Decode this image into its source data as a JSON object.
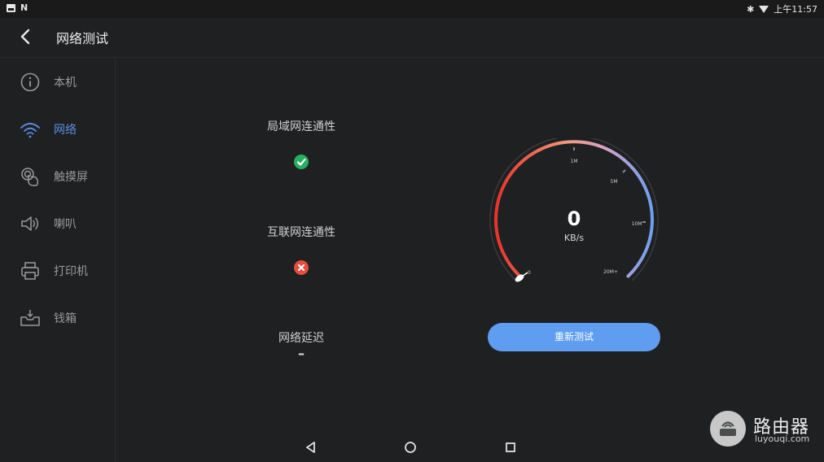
{
  "statusbar": {
    "left_glyph": "N",
    "bluetooth_glyph": "✱",
    "time": "上午11:57"
  },
  "header": {
    "title": "网络测试",
    "back_icon": "chevron-left-icon"
  },
  "sidebar": {
    "items": [
      {
        "label": "本机",
        "icon": "info-icon",
        "active": false
      },
      {
        "label": "网络",
        "icon": "wifi-icon",
        "active": true
      },
      {
        "label": "触摸屏",
        "icon": "touch-icon",
        "active": false
      },
      {
        "label": "喇叭",
        "icon": "speaker-icon",
        "active": false
      },
      {
        "label": "打印机",
        "icon": "printer-icon",
        "active": false
      },
      {
        "label": "钱箱",
        "icon": "cash-drawer-icon",
        "active": false
      }
    ]
  },
  "main": {
    "lan": {
      "label": "局域网连通性",
      "status": "ok"
    },
    "internet": {
      "label": "互联网连通性",
      "status": "fail"
    },
    "latency": {
      "label": "网络延迟",
      "value": "–"
    },
    "gauge": {
      "speed": "0",
      "unit": "KB/s",
      "ticks": [
        "0",
        "1M",
        "5M",
        "10M",
        "20M+"
      ]
    },
    "retest_label": "重新测试"
  },
  "watermark": {
    "title": "路由器",
    "subtitle": "luyouqi.com"
  },
  "colors": {
    "accent": "#5e9df0",
    "ok": "#27ae60",
    "fail": "#e74c3c",
    "background": "#1f2022"
  }
}
